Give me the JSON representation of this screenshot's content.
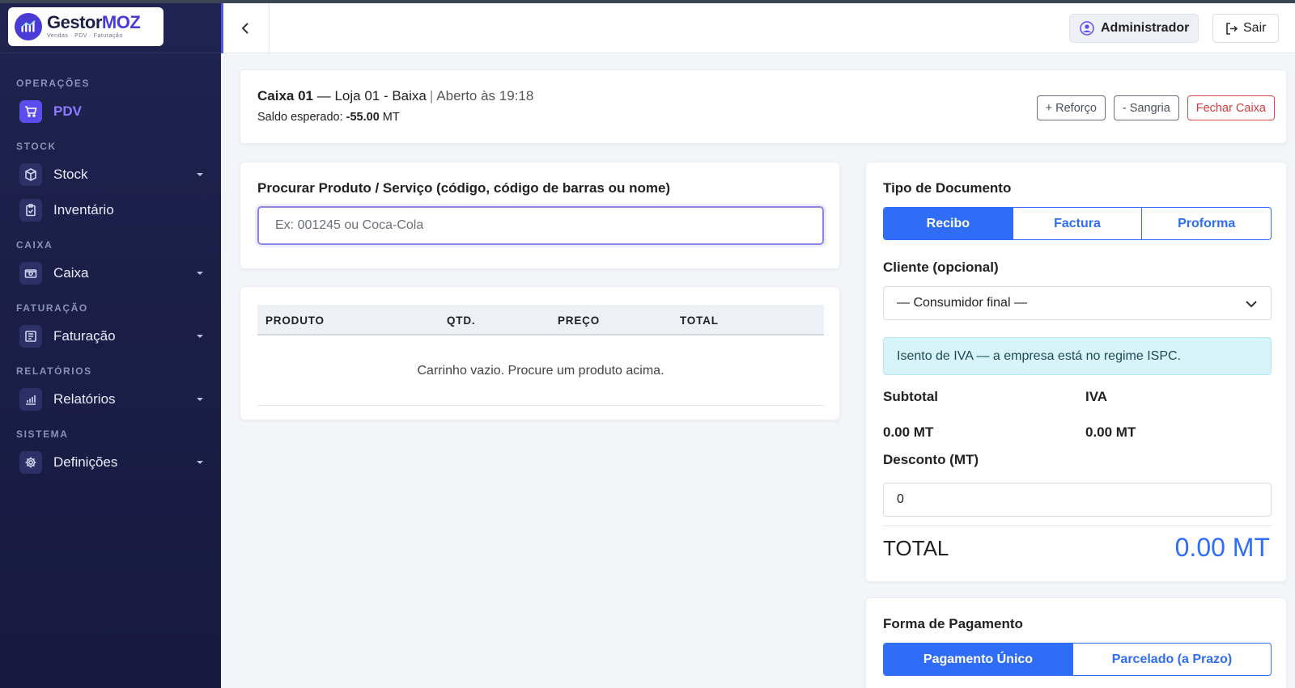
{
  "brand": {
    "name_a": "Gestor",
    "name_b": "MOZ",
    "tagline": "Vendas · PDV · Faturação"
  },
  "sidebar": {
    "sections": [
      {
        "title": "OPERAÇÕES",
        "items": [
          {
            "label": "PDV",
            "icon": "cart-icon",
            "active": true,
            "caret": false
          }
        ]
      },
      {
        "title": "STOCK",
        "items": [
          {
            "label": "Stock",
            "icon": "box-icon",
            "caret": true
          },
          {
            "label": "Inventário",
            "icon": "clipboard-icon",
            "caret": false
          }
        ]
      },
      {
        "title": "CAIXA",
        "items": [
          {
            "label": "Caixa",
            "icon": "cash-icon",
            "caret": true
          }
        ]
      },
      {
        "title": "FATURAÇÃO",
        "items": [
          {
            "label": "Faturação",
            "icon": "invoice-icon",
            "caret": true
          }
        ]
      },
      {
        "title": "RELATÓRIOS",
        "items": [
          {
            "label": "Relatórios",
            "icon": "chart-icon",
            "caret": true
          }
        ]
      },
      {
        "title": "SISTEMA",
        "items": [
          {
            "label": "Definições",
            "icon": "gear-icon",
            "caret": true
          }
        ]
      }
    ]
  },
  "header": {
    "user_label": "Administrador",
    "logout_label": "Sair"
  },
  "caixa": {
    "name": "Caixa 01",
    "store": "— Loja 01 - Baixa",
    "opened": "Aberto às 19:18",
    "saldo_label": "Saldo esperado:",
    "saldo_value": "-55.00",
    "saldo_unit": "MT",
    "reforco_label": "+ Reforço",
    "sangria_label": "- Sangria",
    "fechar_label": "Fechar Caixa"
  },
  "search": {
    "label": "Procurar Produto / Serviço (código, código de barras ou nome)",
    "placeholder": "Ex: 001245 ou Coca-Cola"
  },
  "cart": {
    "columns": [
      "PRODUTO",
      "QTD.",
      "PREÇO",
      "TOTAL"
    ],
    "empty_text": "Carrinho vazio. Procure um produto acima."
  },
  "document": {
    "title": "Tipo de Documento",
    "types": [
      "Recibo",
      "Factura",
      "Proforma"
    ],
    "selected": "Recibo",
    "cliente_label": "Cliente (opcional)",
    "cliente_value": "— Consumidor final —",
    "iva_notice": "Isento de IVA — a empresa está no regime ISPC.",
    "subtotal_label": "Subtotal",
    "subtotal_value": "0.00 MT",
    "iva_label": "IVA",
    "iva_value": "0.00 MT",
    "desconto_label": "Desconto (MT)",
    "desconto_value": "0",
    "total_label": "TOTAL",
    "total_value": "0.00 MT"
  },
  "payment": {
    "title": "Forma de Pagamento",
    "options": [
      "Pagamento Único",
      "Parcelado (a Prazo)"
    ],
    "selected": "Pagamento Único"
  },
  "colors": {
    "primary": "#2f6df6",
    "accent": "#5b4cf0",
    "sidebar_bg": "#1a1f48",
    "danger": "#d83a3a",
    "info_bg": "#d6f4fa"
  }
}
